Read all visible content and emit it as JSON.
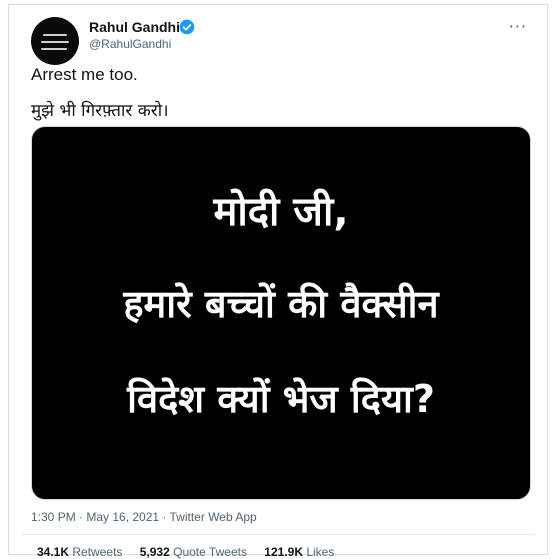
{
  "tweet": {
    "author_name": "Rahul Gandhi",
    "author_handle": "@RahulGandhi",
    "more_icon": "more-options-icon",
    "text_english": "Arrest me too.",
    "text_hindi": "मुझे भी गिरफ़्तार करो।",
    "image_text": {
      "line1": "मोदी जी,",
      "line2": "हमारे बच्चों की वैक्सीन",
      "line3": "विदेश क्यों भेज दिया?"
    },
    "meta": "1:30 PM · May 16, 2021 · Twitter Web App",
    "stats": {
      "retweets_count": "34.1K",
      "retweets_label": "Retweets",
      "quotes_count": "5,932",
      "quotes_label": "Quote Tweets",
      "likes_count": "121.9K",
      "likes_label": "Likes"
    }
  },
  "colors": {
    "verified": "#1d9bf0",
    "secondary_text": "#536471",
    "primary_text": "#0f1419",
    "media_background": "#000000"
  }
}
